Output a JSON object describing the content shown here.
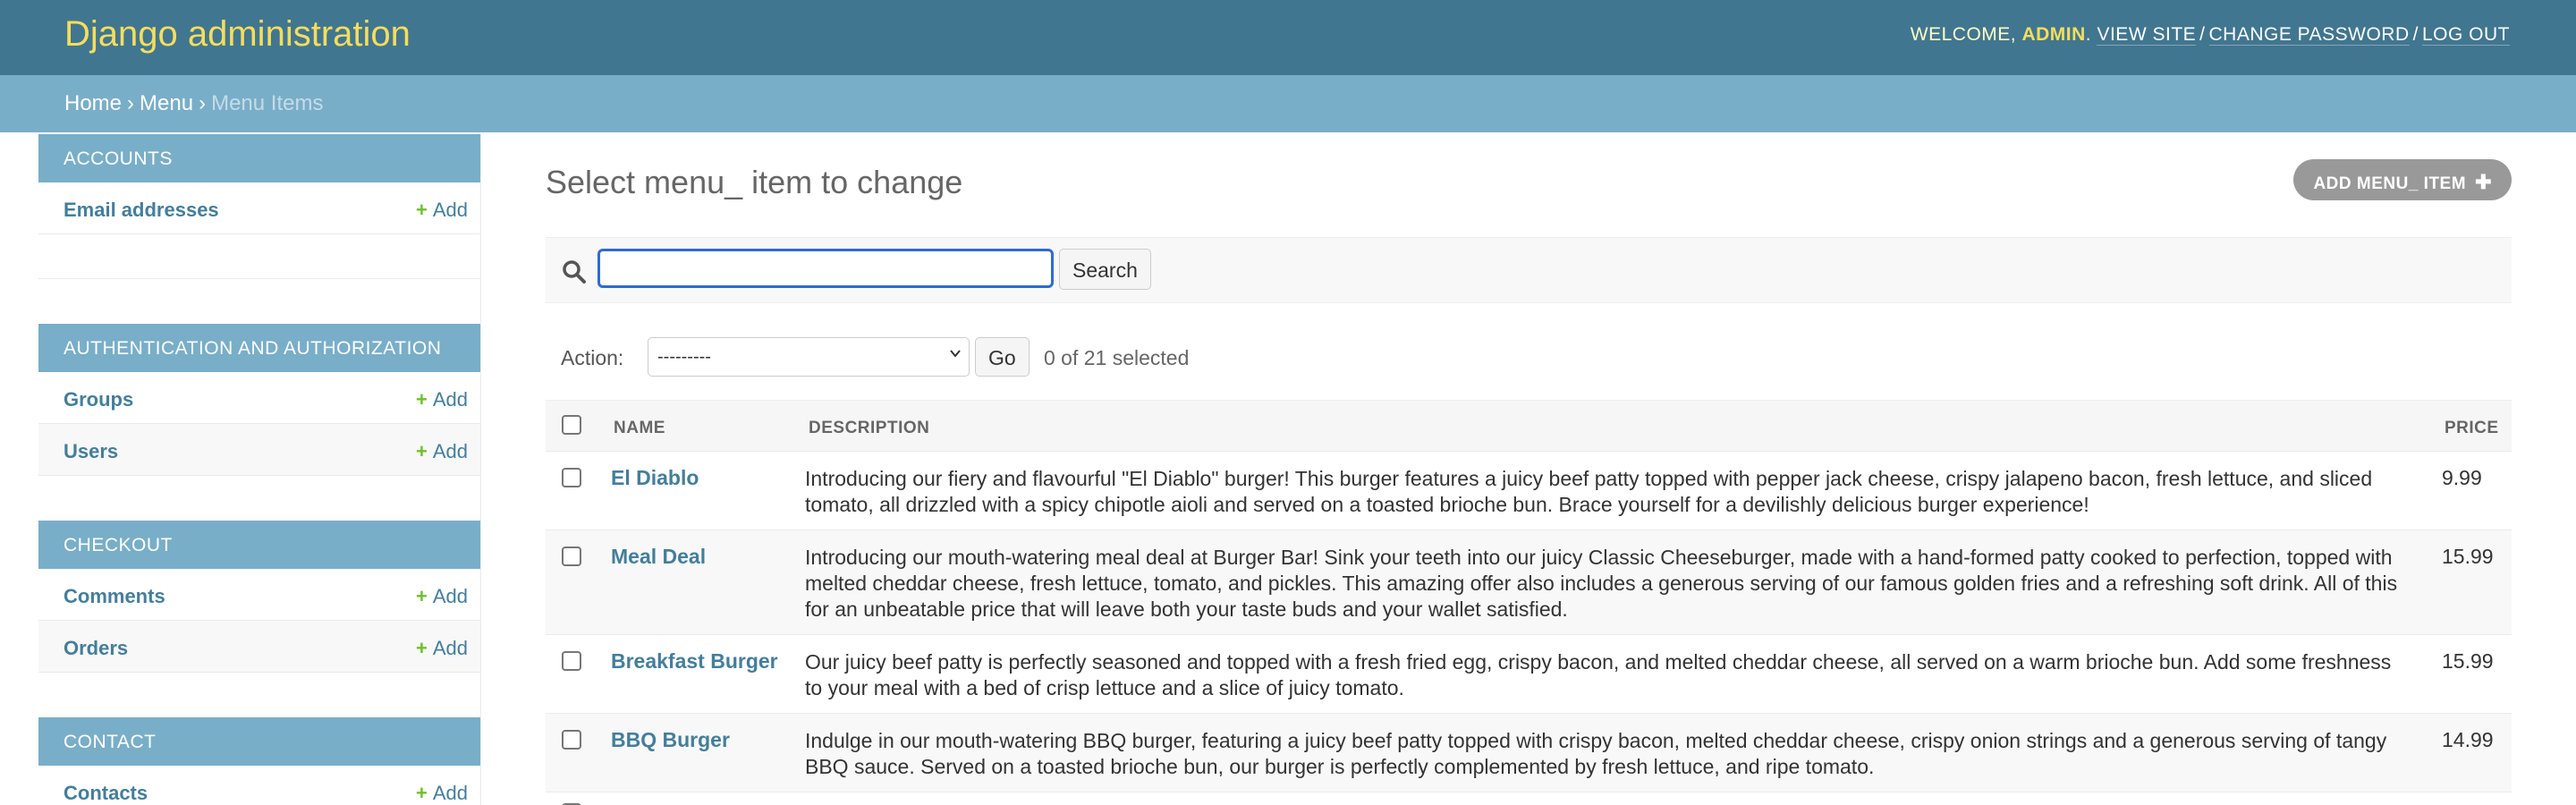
{
  "header": {
    "branding": "Django administration",
    "welcome": "WELCOME,",
    "user": "ADMIN",
    "view_site": "VIEW SITE",
    "change_password": "CHANGE PASSWORD",
    "log_out": "LOG OUT"
  },
  "breadcrumbs": {
    "home": "Home",
    "app": "Menu",
    "current": "Menu Items"
  },
  "sidebar": {
    "add_label": "Add",
    "modules": [
      {
        "caption": "ACCOUNTS",
        "items": [
          "Email addresses"
        ]
      },
      {
        "caption": "AUTHENTICATION AND AUTHORIZATION",
        "items": [
          "Groups",
          "Users"
        ]
      },
      {
        "caption": "CHECKOUT",
        "items": [
          "Comments",
          "Orders"
        ]
      },
      {
        "caption": "CONTACT",
        "items": [
          "Contacts"
        ]
      }
    ]
  },
  "content": {
    "title": "Select menu_ item to change",
    "add_button": "ADD MENU_ ITEM",
    "search": {
      "value": "",
      "button": "Search"
    },
    "actions": {
      "label": "Action:",
      "selected_option": "---------",
      "go": "Go",
      "counter": "0 of 21 selected"
    },
    "table": {
      "columns": [
        "NAME",
        "DESCRIPTION",
        "PRICE"
      ],
      "rows": [
        {
          "name": "El Diablo",
          "description": "Introducing our fiery and flavourful \"El Diablo\" burger! This burger features a juicy beef patty topped with pepper jack cheese, crispy jalapeno bacon, fresh lettuce, and sliced tomato, all drizzled with a spicy chipotle aioli and served on a toasted brioche bun. Brace yourself for a devilishly delicious burger experience!",
          "price": "9.99"
        },
        {
          "name": "Meal Deal",
          "description": "Introducing our mouth-watering meal deal at Burger Bar! Sink your teeth into our juicy Classic Cheeseburger, made with a hand-formed patty cooked to perfection, topped with melted cheddar cheese, fresh lettuce, tomato, and pickles. This amazing offer also includes a generous serving of our famous golden fries and a refreshing soft drink. All of this for an unbeatable price that will leave both your taste buds and your wallet satisfied.",
          "price": "15.99"
        },
        {
          "name": "Breakfast Burger",
          "description": "Our juicy beef patty is perfectly seasoned and topped with a fresh fried egg, crispy bacon, and melted cheddar cheese, all served on a warm brioche bun. Add some freshness to your meal with a bed of crisp lettuce and a slice of juicy tomato.",
          "price": "15.99"
        },
        {
          "name": "BBQ Burger",
          "description": "Indulge in our mouth-watering BBQ burger, featuring a juicy beef patty topped with crispy bacon, melted cheddar cheese, crispy onion strings and a generous serving of tangy BBQ sauce. Served on a toasted brioche bun, our burger is perfectly complemented by fresh lettuce, and ripe tomato.",
          "price": "14.99"
        }
      ]
    }
  }
}
